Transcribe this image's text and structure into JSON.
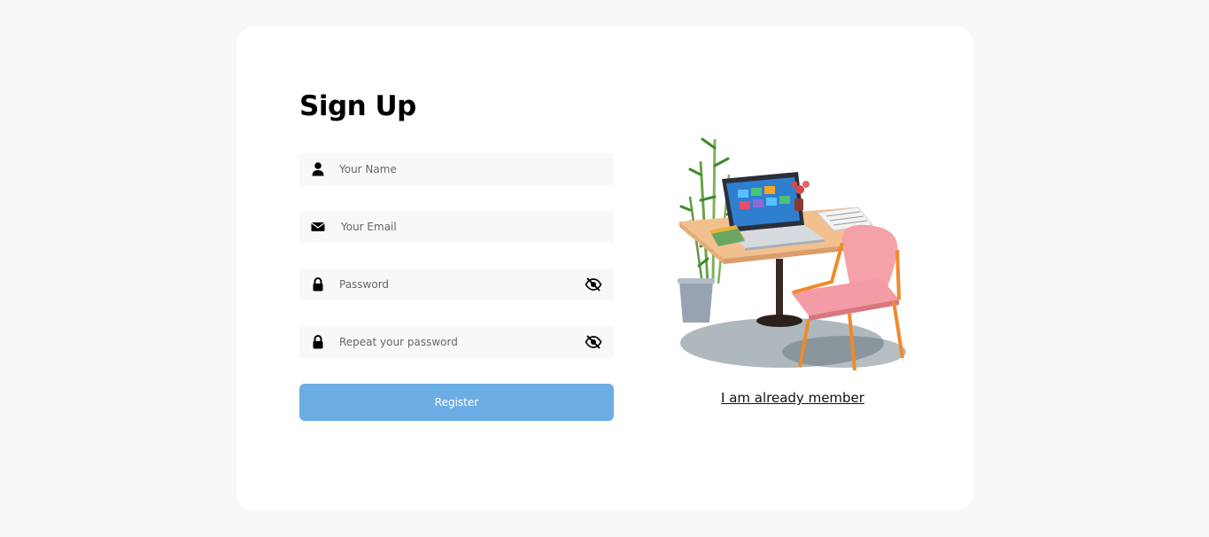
{
  "form": {
    "title": "Sign Up",
    "name_placeholder": "Your Name",
    "email_placeholder": "Your Email",
    "password_placeholder": "Password",
    "repeat_password_placeholder": "Repeat your password",
    "register_label": "Register"
  },
  "aside": {
    "member_link": "I am already member"
  },
  "icons": {
    "name": "user-icon",
    "email": "envelope-icon",
    "password": "lock-icon",
    "repeat_password": "lock-icon",
    "toggle_visibility": "eye-slash-icon"
  },
  "colors": {
    "page_background": "#f8f8f8",
    "card_background": "#ffffff",
    "field_background": "#f8f8f8",
    "button_background": "#6dade5",
    "button_text": "#ffffff"
  }
}
